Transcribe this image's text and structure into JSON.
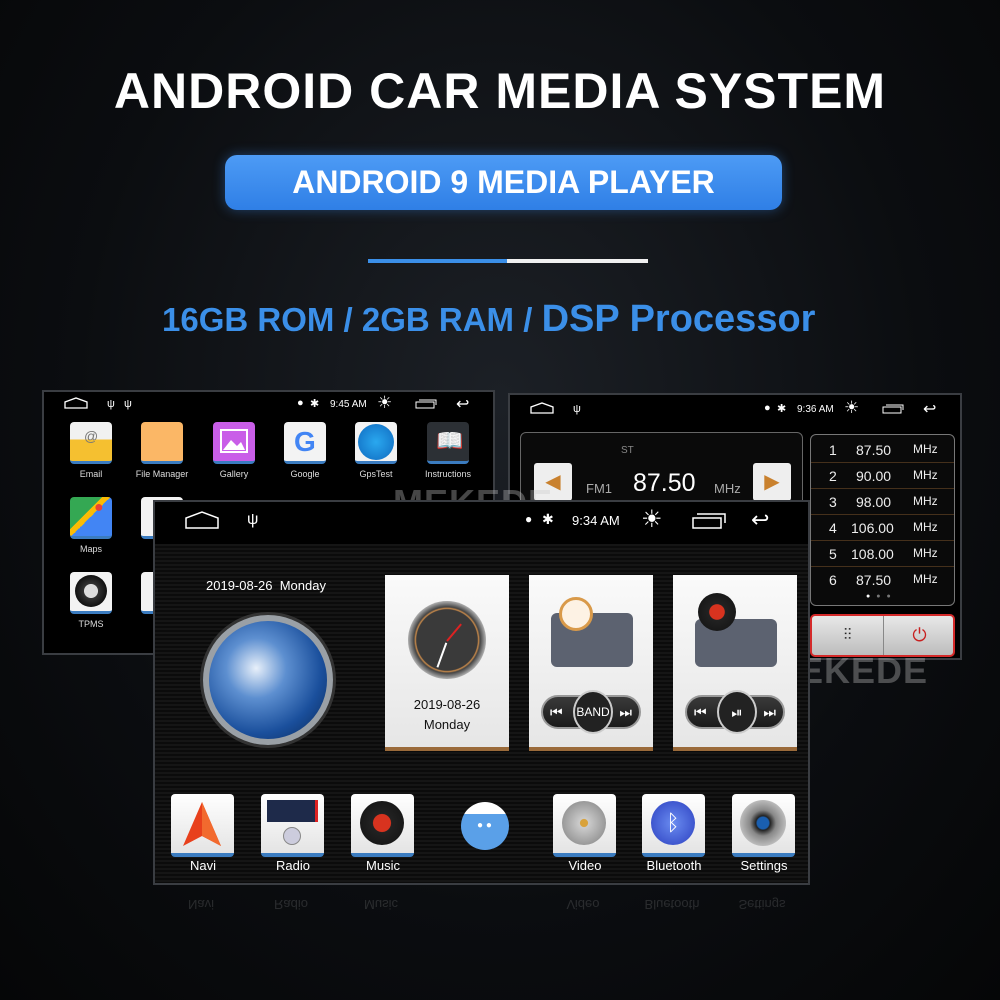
{
  "header": {
    "title": "ANDROID CAR MEDIA SYSTEM",
    "subtitle": "ANDROID 9 MEDIA PLAYER",
    "specs_part1": "16GB ROM / 2GB RAM / ",
    "specs_part2": "DSP Processor"
  },
  "colors": {
    "accent": "#3b8fe8",
    "background": "#0b0d10",
    "radio_button_border": "#d42a2a"
  },
  "watermark": "MEKEDE",
  "app_drawer_screen": {
    "status": {
      "time": "9:45 AM",
      "icons": [
        "home-icon",
        "usb-icon",
        "usb-icon",
        "location-icon",
        "bluetooth-icon",
        "brightness-icon",
        "recents-icon",
        "back-icon"
      ]
    },
    "apps": [
      {
        "label": "Email",
        "icon": "email-icon"
      },
      {
        "label": "File Manager",
        "icon": "folder-icon"
      },
      {
        "label": "Gallery",
        "icon": "gallery-icon"
      },
      {
        "label": "Google",
        "icon": "google-icon"
      },
      {
        "label": "GpsTest",
        "icon": "radar-icon"
      },
      {
        "label": "Instructions",
        "icon": "book-icon"
      },
      {
        "label": "Maps",
        "icon": "maps-icon"
      },
      {
        "label": "TPMS",
        "icon": "tire-icon"
      }
    ]
  },
  "radio_screen": {
    "status": {
      "time": "9:36 AM"
    },
    "stereo": "ST",
    "band": "FM1",
    "frequency": "87.50",
    "unit": "MHz",
    "presets": [
      {
        "num": "1",
        "freq": "87.50",
        "unit": "MHz"
      },
      {
        "num": "2",
        "freq": "90.00",
        "unit": "MHz"
      },
      {
        "num": "3",
        "freq": "98.00",
        "unit": "MHz"
      },
      {
        "num": "4",
        "freq": "106.00",
        "unit": "MHz"
      },
      {
        "num": "5",
        "freq": "108.00",
        "unit": "MHz"
      },
      {
        "num": "6",
        "freq": "87.50",
        "unit": "MHz"
      }
    ],
    "preset_page": 1,
    "preset_pages": 3
  },
  "home_screen": {
    "status": {
      "time": "9:34 AM"
    },
    "date_header": "2019-08-26  Monday",
    "clock_card": {
      "date": "2019-08-26",
      "day": "Monday"
    },
    "radio_card": {
      "band_label": "BAND"
    },
    "dock": [
      {
        "label": "Navi",
        "icon": "navigation-icon"
      },
      {
        "label": "Radio",
        "icon": "radio-icon"
      },
      {
        "label": "Music",
        "icon": "music-icon"
      },
      {
        "label": "Video",
        "icon": "video-reel-icon"
      },
      {
        "label": "Bluetooth",
        "icon": "bluetooth-icon"
      },
      {
        "label": "Settings",
        "icon": "settings-icon"
      }
    ]
  }
}
